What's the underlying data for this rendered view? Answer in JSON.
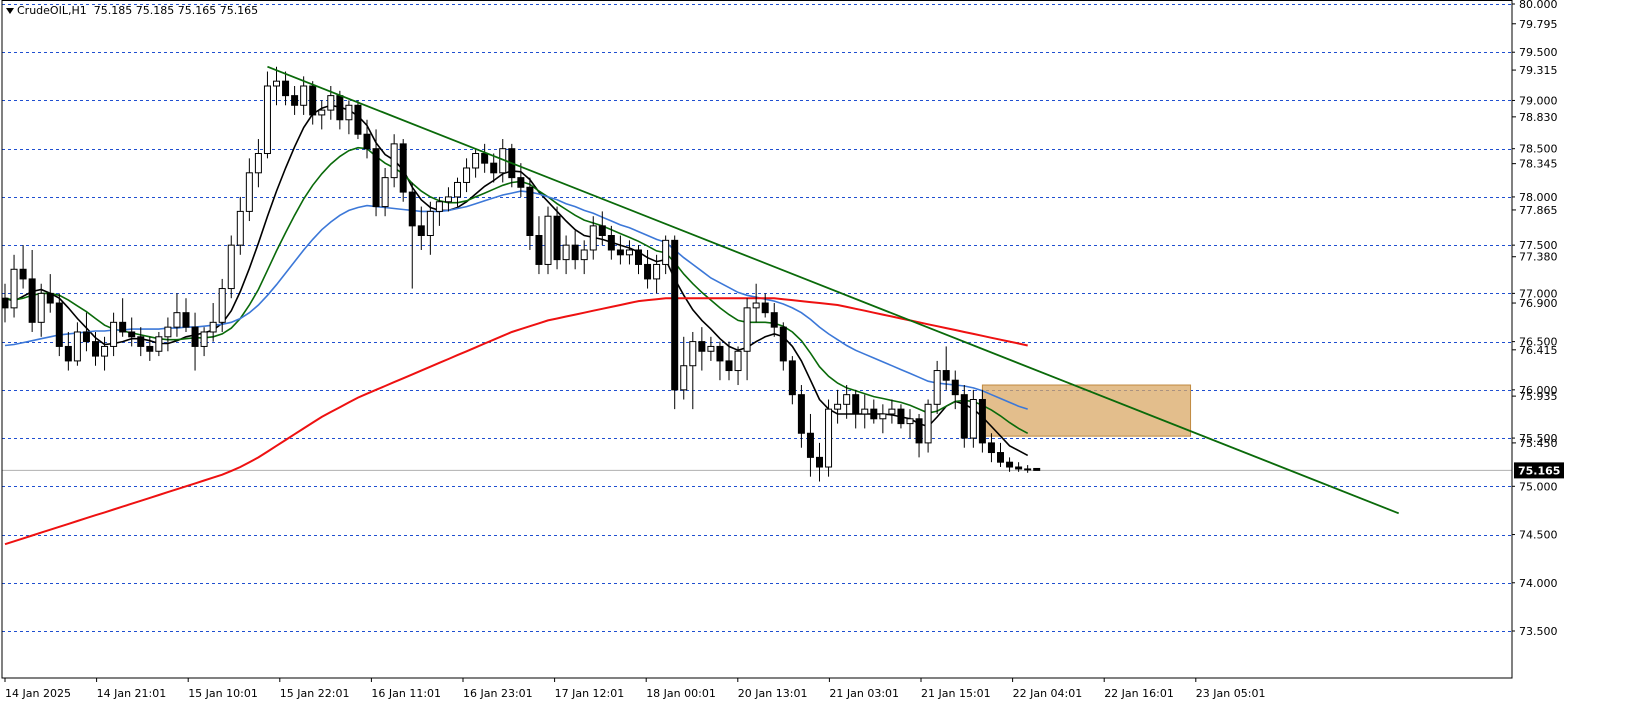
{
  "header": {
    "symbol": "CrudeOIL,H1",
    "ohlc": "75.185 75.185 75.165 75.165"
  },
  "colors": {
    "background": "#ffffff",
    "grid": "#1f4fd0",
    "candle": "#000000",
    "ma_fast": "#000000",
    "ma_mid": "#0a6a0a",
    "ma_slow": "#3c78d8",
    "ma_long": "#ee1111",
    "trendline": "#0a6a0a",
    "zone": "#d9a866",
    "current_price_line": "#b0b0b0",
    "price_badge_bg": "#000000",
    "price_badge_fg": "#ffffff"
  },
  "chart_data": {
    "type": "candlestick",
    "symbol": "CrudeOIL",
    "timeframe": "H1",
    "ylim": [
      73.35,
      80.0
    ],
    "price_ticks": [
      "80.000",
      "79.795",
      "79.500",
      "79.315",
      "79.000",
      "78.830",
      "78.500",
      "78.345",
      "78.000",
      "77.865",
      "77.500",
      "77.380",
      "77.000",
      "76.900",
      "76.500",
      "76.415",
      "76.000",
      "75.935",
      "75.500",
      "75.450",
      "75.000",
      "74.500",
      "74.000",
      "73.500"
    ],
    "highlighted_levels": [
      "80.000",
      "79.500",
      "79.000",
      "78.500",
      "78.000",
      "77.500",
      "77.000",
      "76.500",
      "76.000",
      "75.500",
      "75.000",
      "74.500",
      "74.000",
      "73.500"
    ],
    "x_labels": [
      "14 Jan 2025",
      "14 Jan 21:01",
      "15 Jan 10:01",
      "15 Jan 22:01",
      "16 Jan 11:01",
      "16 Jan 23:01",
      "17 Jan 12:01",
      "18 Jan 00:01",
      "20 Jan 13:01",
      "21 Jan 03:01",
      "21 Jan 15:01",
      "22 Jan 04:01",
      "22 Jan 16:01",
      "23 Jan 05:01"
    ],
    "current_price": "75.165",
    "ohlc": [
      [
        76.95,
        77.1,
        76.7,
        76.85
      ],
      [
        76.85,
        77.4,
        76.75,
        77.25
      ],
      [
        77.25,
        77.5,
        77.05,
        77.15
      ],
      [
        77.15,
        77.45,
        76.6,
        76.7
      ],
      [
        76.7,
        77.1,
        76.55,
        77.0
      ],
      [
        77.0,
        77.2,
        76.8,
        76.9
      ],
      [
        76.9,
        77.0,
        76.35,
        76.45
      ],
      [
        76.45,
        76.6,
        76.2,
        76.3
      ],
      [
        76.3,
        76.7,
        76.25,
        76.6
      ],
      [
        76.6,
        76.8,
        76.4,
        76.5
      ],
      [
        76.5,
        76.6,
        76.25,
        76.35
      ],
      [
        76.35,
        76.55,
        76.2,
        76.45
      ],
      [
        76.45,
        76.8,
        76.35,
        76.7
      ],
      [
        76.7,
        76.95,
        76.55,
        76.6
      ],
      [
        76.6,
        76.75,
        76.45,
        76.55
      ],
      [
        76.55,
        76.65,
        76.35,
        76.45
      ],
      [
        76.45,
        76.55,
        76.3,
        76.4
      ],
      [
        76.4,
        76.6,
        76.35,
        76.55
      ],
      [
        76.55,
        76.75,
        76.4,
        76.65
      ],
      [
        76.65,
        77.0,
        76.55,
        76.8
      ],
      [
        76.8,
        76.95,
        76.6,
        76.65
      ],
      [
        76.65,
        76.8,
        76.2,
        76.45
      ],
      [
        76.45,
        76.65,
        76.35,
        76.6
      ],
      [
        76.6,
        76.9,
        76.5,
        76.7
      ],
      [
        76.7,
        77.15,
        76.6,
        77.05
      ],
      [
        77.05,
        77.6,
        76.95,
        77.5
      ],
      [
        77.5,
        78.0,
        77.4,
        77.85
      ],
      [
        77.85,
        78.4,
        77.75,
        78.25
      ],
      [
        78.25,
        78.6,
        78.1,
        78.45
      ],
      [
        78.45,
        79.3,
        78.4,
        79.15
      ],
      [
        79.15,
        79.35,
        78.95,
        79.2
      ],
      [
        79.2,
        79.3,
        78.95,
        79.05
      ],
      [
        79.05,
        79.15,
        78.85,
        78.95
      ],
      [
        78.95,
        79.25,
        78.85,
        79.15
      ],
      [
        79.15,
        79.2,
        78.75,
        78.85
      ],
      [
        78.85,
        79.0,
        78.7,
        78.9
      ],
      [
        78.9,
        79.15,
        78.8,
        79.05
      ],
      [
        79.05,
        79.1,
        78.7,
        78.8
      ],
      [
        78.8,
        79.0,
        78.65,
        78.95
      ],
      [
        78.95,
        79.0,
        78.6,
        78.65
      ],
      [
        78.65,
        78.8,
        78.4,
        78.5
      ],
      [
        78.5,
        78.7,
        77.8,
        77.9
      ],
      [
        77.9,
        78.3,
        77.8,
        78.2
      ],
      [
        78.2,
        78.65,
        78.1,
        78.55
      ],
      [
        78.55,
        78.6,
        77.95,
        78.05
      ],
      [
        78.05,
        78.15,
        77.05,
        77.7
      ],
      [
        77.7,
        77.9,
        77.45,
        77.6
      ],
      [
        77.6,
        77.95,
        77.4,
        77.85
      ],
      [
        77.85,
        78.0,
        77.7,
        77.95
      ],
      [
        77.95,
        78.1,
        77.85,
        78.0
      ],
      [
        78.0,
        78.2,
        77.9,
        78.15
      ],
      [
        78.15,
        78.4,
        78.05,
        78.3
      ],
      [
        78.3,
        78.5,
        78.2,
        78.45
      ],
      [
        78.45,
        78.55,
        78.25,
        78.35
      ],
      [
        78.35,
        78.45,
        78.15,
        78.25
      ],
      [
        78.25,
        78.6,
        78.15,
        78.5
      ],
      [
        78.5,
        78.55,
        78.1,
        78.2
      ],
      [
        78.2,
        78.35,
        78.0,
        78.1
      ],
      [
        78.1,
        78.2,
        77.45,
        77.6
      ],
      [
        77.6,
        77.8,
        77.2,
        77.3
      ],
      [
        77.3,
        77.9,
        77.2,
        77.8
      ],
      [
        77.8,
        77.9,
        77.25,
        77.35
      ],
      [
        77.35,
        77.6,
        77.2,
        77.5
      ],
      [
        77.5,
        77.65,
        77.25,
        77.35
      ],
      [
        77.35,
        77.55,
        77.2,
        77.45
      ],
      [
        77.45,
        77.8,
        77.35,
        77.7
      ],
      [
        77.7,
        77.85,
        77.5,
        77.6
      ],
      [
        77.6,
        77.7,
        77.35,
        77.45
      ],
      [
        77.45,
        77.6,
        77.3,
        77.4
      ],
      [
        77.4,
        77.55,
        77.3,
        77.45
      ],
      [
        77.45,
        77.5,
        77.2,
        77.3
      ],
      [
        77.3,
        77.45,
        77.05,
        77.15
      ],
      [
        77.15,
        77.4,
        77.0,
        77.3
      ],
      [
        77.3,
        77.6,
        77.2,
        77.55
      ],
      [
        77.55,
        77.6,
        75.8,
        76.0
      ],
      [
        76.0,
        76.55,
        75.9,
        76.25
      ],
      [
        76.25,
        76.6,
        75.8,
        76.5
      ],
      [
        76.5,
        76.65,
        76.2,
        76.4
      ],
      [
        76.4,
        76.55,
        76.3,
        76.45
      ],
      [
        76.45,
        76.5,
        76.1,
        76.3
      ],
      [
        76.3,
        76.5,
        76.1,
        76.2
      ],
      [
        76.2,
        76.45,
        76.05,
        76.4
      ],
      [
        76.4,
        76.95,
        76.1,
        76.85
      ],
      [
        76.85,
        77.1,
        76.7,
        76.9
      ],
      [
        76.9,
        77.0,
        76.75,
        76.8
      ],
      [
        76.8,
        76.9,
        76.55,
        76.65
      ],
      [
        76.65,
        76.7,
        76.2,
        76.3
      ],
      [
        76.3,
        76.35,
        75.85,
        75.95
      ],
      [
        75.95,
        76.05,
        75.4,
        75.55
      ],
      [
        75.55,
        75.75,
        75.1,
        75.3
      ],
      [
        75.3,
        75.45,
        75.05,
        75.2
      ],
      [
        75.2,
        75.9,
        75.1,
        75.8
      ],
      [
        75.8,
        76.0,
        75.65,
        75.85
      ],
      [
        75.85,
        76.05,
        75.7,
        75.95
      ],
      [
        75.95,
        76.0,
        75.6,
        75.75
      ],
      [
        75.75,
        75.95,
        75.6,
        75.8
      ],
      [
        75.8,
        75.9,
        75.65,
        75.7
      ],
      [
        75.7,
        75.85,
        75.55,
        75.75
      ],
      [
        75.75,
        75.9,
        75.65,
        75.8
      ],
      [
        75.8,
        75.85,
        75.6,
        75.65
      ],
      [
        75.65,
        75.8,
        75.5,
        75.7
      ],
      [
        75.7,
        75.75,
        75.3,
        75.45
      ],
      [
        75.45,
        75.9,
        75.35,
        75.85
      ],
      [
        75.85,
        76.3,
        75.75,
        76.2
      ],
      [
        76.2,
        76.45,
        76.0,
        76.1
      ],
      [
        76.1,
        76.2,
        75.8,
        75.95
      ],
      [
        75.95,
        76.05,
        75.4,
        75.5
      ],
      [
        75.5,
        76.0,
        75.4,
        75.9
      ],
      [
        75.9,
        76.0,
        75.35,
        75.45
      ],
      [
        75.45,
        75.55,
        75.25,
        75.35
      ],
      [
        75.35,
        75.45,
        75.2,
        75.25
      ],
      [
        75.25,
        75.3,
        75.15,
        75.2
      ],
      [
        75.2,
        75.25,
        75.15,
        75.18
      ],
      [
        75.18,
        75.22,
        75.14,
        75.17
      ],
      [
        75.185,
        75.185,
        75.165,
        75.165
      ]
    ],
    "moving_averages": [
      {
        "color": "#000000",
        "values": [
          76.95,
          76.92,
          76.97,
          77.02,
          77.04,
          77.0,
          76.95,
          76.85,
          76.74,
          76.64,
          76.54,
          76.47,
          76.48,
          76.5,
          76.53,
          76.53,
          76.51,
          76.48,
          76.48,
          76.51,
          76.55,
          76.57,
          76.59,
          76.62,
          76.69,
          76.82,
          77.02,
          77.26,
          77.52,
          77.8,
          78.06,
          78.3,
          78.52,
          78.72,
          78.86,
          78.92,
          78.95,
          78.93,
          78.9,
          78.84,
          78.74,
          78.56,
          78.44,
          78.38,
          78.28,
          78.1,
          77.97,
          77.89,
          77.86,
          77.86,
          77.89,
          77.95,
          78.03,
          78.11,
          78.17,
          78.24,
          78.27,
          78.26,
          78.18,
          78.05,
          77.95,
          77.85,
          77.75,
          77.66,
          77.6,
          77.58,
          77.56,
          77.53,
          77.5,
          77.47,
          77.43,
          77.37,
          77.33,
          77.35,
          77.15,
          76.98,
          76.83,
          76.72,
          76.63,
          76.53,
          76.45,
          76.41,
          76.44,
          76.5,
          76.55,
          76.58,
          76.55,
          76.45,
          76.3,
          76.1,
          75.9,
          75.8,
          75.75,
          75.75,
          75.75,
          75.75,
          75.75,
          75.75,
          75.74,
          75.72,
          75.7,
          75.65,
          75.62,
          75.72,
          75.83,
          75.88,
          75.85,
          75.8,
          75.72,
          75.62,
          75.52,
          75.42,
          75.37,
          75.32
        ]
      },
      {
        "color": "#0a6a0a",
        "values": [
          76.95,
          76.93,
          76.95,
          76.98,
          77.0,
          77.0,
          76.98,
          76.93,
          76.87,
          76.81,
          76.74,
          76.67,
          76.63,
          76.61,
          76.59,
          76.57,
          76.55,
          76.53,
          76.52,
          76.52,
          76.53,
          76.54,
          76.54,
          76.55,
          76.58,
          76.64,
          76.74,
          76.88,
          77.04,
          77.24,
          77.44,
          77.63,
          77.81,
          77.98,
          78.12,
          78.24,
          78.34,
          78.42,
          78.48,
          78.51,
          78.5,
          78.42,
          78.35,
          78.3,
          78.24,
          78.14,
          78.06,
          78.0,
          77.96,
          77.94,
          77.94,
          77.96,
          78.0,
          78.04,
          78.08,
          78.12,
          78.15,
          78.16,
          78.13,
          78.06,
          78.0,
          77.93,
          77.87,
          77.81,
          77.76,
          77.73,
          77.7,
          77.66,
          77.62,
          77.58,
          77.54,
          77.49,
          77.44,
          77.42,
          77.32,
          77.2,
          77.1,
          77.01,
          76.93,
          76.85,
          76.78,
          76.72,
          76.7,
          76.7,
          76.7,
          76.69,
          76.66,
          76.6,
          76.51,
          76.38,
          76.24,
          76.14,
          76.07,
          76.02,
          75.99,
          75.96,
          75.93,
          75.91,
          75.89,
          75.87,
          75.84,
          75.8,
          75.76,
          75.78,
          75.83,
          75.88,
          75.89,
          75.88,
          75.84,
          75.79,
          75.73,
          75.66,
          75.6,
          75.55
        ]
      },
      {
        "color": "#3c78d8",
        "values": [
          76.46,
          76.47,
          76.49,
          76.51,
          76.53,
          76.55,
          76.57,
          76.58,
          76.59,
          76.6,
          76.61,
          76.61,
          76.62,
          76.62,
          76.63,
          76.63,
          76.63,
          76.63,
          76.64,
          76.64,
          76.65,
          76.65,
          76.66,
          76.67,
          76.68,
          76.7,
          76.74,
          76.8,
          76.88,
          76.98,
          77.09,
          77.21,
          77.33,
          77.45,
          77.56,
          77.66,
          77.74,
          77.81,
          77.86,
          77.89,
          77.91,
          77.9,
          77.89,
          77.88,
          77.87,
          77.86,
          77.85,
          77.85,
          77.85,
          77.86,
          77.88,
          77.9,
          77.93,
          77.96,
          77.99,
          78.02,
          78.04,
          78.06,
          78.05,
          78.03,
          78.0,
          77.97,
          77.93,
          77.9,
          77.86,
          77.83,
          77.79,
          77.75,
          77.71,
          77.68,
          77.64,
          77.6,
          77.56,
          77.53,
          77.45,
          77.37,
          77.3,
          77.23,
          77.16,
          77.11,
          77.06,
          77.01,
          76.98,
          76.96,
          76.94,
          76.92,
          76.89,
          76.85,
          76.8,
          76.73,
          76.65,
          76.58,
          76.52,
          76.46,
          76.41,
          76.37,
          76.33,
          76.29,
          76.25,
          76.21,
          76.17,
          76.13,
          76.09,
          76.07,
          76.06,
          76.05,
          76.04,
          76.02,
          75.99,
          75.95,
          75.91,
          75.87,
          75.83,
          75.8
        ]
      },
      {
        "color": "#ee1111",
        "values": [
          74.4,
          74.43,
          74.46,
          74.49,
          74.52,
          74.55,
          74.58,
          74.61,
          74.64,
          74.67,
          74.7,
          74.73,
          74.76,
          74.79,
          74.82,
          74.85,
          74.88,
          74.91,
          74.94,
          74.97,
          75.0,
          75.03,
          75.06,
          75.09,
          75.12,
          75.16,
          75.2,
          75.25,
          75.3,
          75.36,
          75.42,
          75.48,
          75.54,
          75.6,
          75.66,
          75.72,
          75.77,
          75.82,
          75.87,
          75.92,
          75.96,
          76.0,
          76.04,
          76.08,
          76.12,
          76.16,
          76.2,
          76.24,
          76.28,
          76.32,
          76.36,
          76.4,
          76.44,
          76.48,
          76.52,
          76.56,
          76.6,
          76.63,
          76.66,
          76.69,
          76.72,
          76.74,
          76.76,
          76.78,
          76.8,
          76.82,
          76.84,
          76.86,
          76.88,
          76.9,
          76.92,
          76.93,
          76.94,
          76.95,
          76.95,
          76.95,
          76.95,
          76.95,
          76.95,
          76.95,
          76.95,
          76.95,
          76.95,
          76.95,
          76.95,
          76.95,
          76.94,
          76.93,
          76.92,
          76.91,
          76.9,
          76.89,
          76.88,
          76.86,
          76.84,
          76.82,
          76.8,
          76.78,
          76.76,
          76.74,
          76.72,
          76.7,
          76.68,
          76.66,
          76.64,
          76.62,
          76.6,
          76.58,
          76.56,
          76.54,
          76.52,
          76.5,
          76.48,
          76.46
        ]
      }
    ],
    "trendline": {
      "from": [
        29,
        79.35
      ],
      "to": [
        154,
        74.72
      ]
    },
    "zone": {
      "from_bar": 108,
      "to_bar": 131,
      "low": 75.52,
      "high": 76.05
    }
  }
}
